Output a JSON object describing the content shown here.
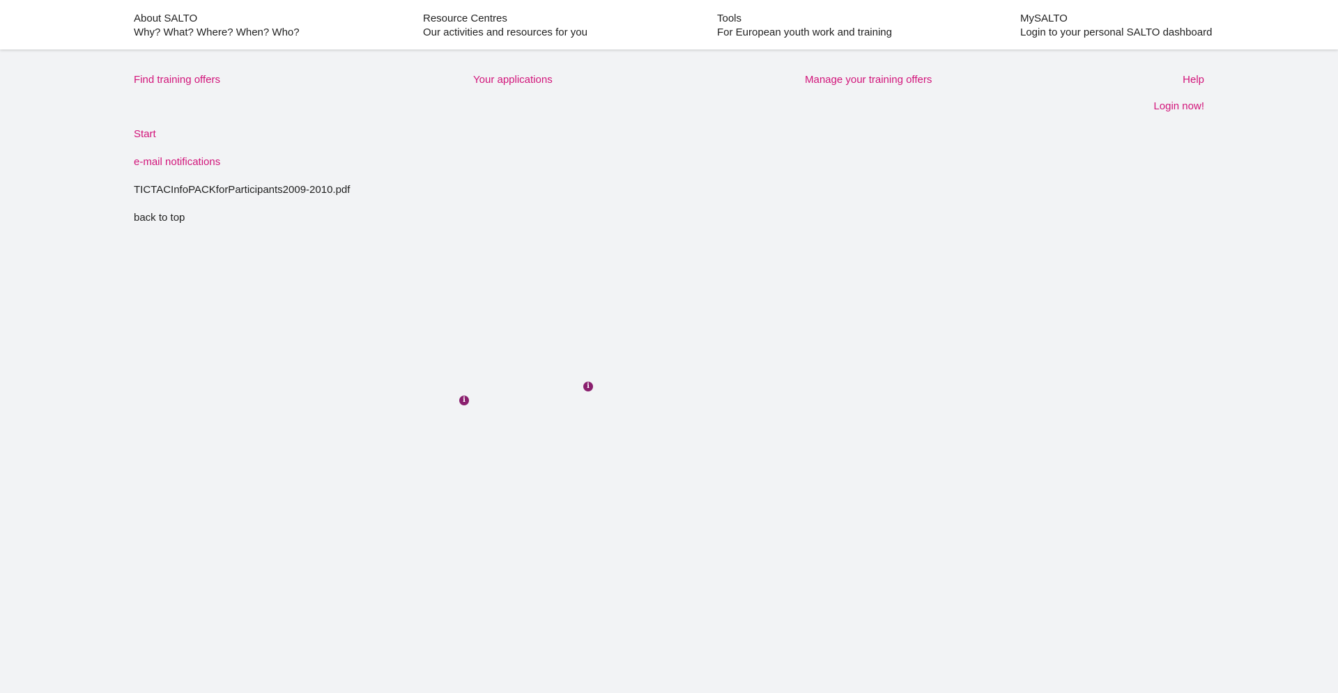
{
  "header": {
    "items": [
      {
        "title": "About SALTO",
        "subtitle": "Why? What? Where? When? Who?"
      },
      {
        "title": "Resource Centres",
        "subtitle": "Our activities and resources for you"
      },
      {
        "title": "Tools",
        "subtitle": "For European youth work and training"
      },
      {
        "title": "MySALTO",
        "subtitle": "Login to your personal SALTO dashboard"
      }
    ]
  },
  "subnav": {
    "find_training": "Find training offers",
    "your_applications": "Your applications",
    "manage_training": "Manage your training offers",
    "help": "Help",
    "login": "Login now!"
  },
  "content": {
    "start": "Start",
    "email_notifications": "e-mail notifications",
    "file_name": "TICTACInfoPACKforParticipants2009-2010.pdf",
    "back_to_top": "back to top"
  },
  "icons": {
    "info_glyph": "i",
    "info_color": "#8a1f6e",
    "link_color": "#d2147a"
  }
}
